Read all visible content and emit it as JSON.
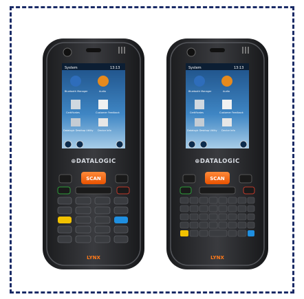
{
  "products": [
    {
      "name": "numeric",
      "brand": "⊕DATALOGIC",
      "scan_label": "SCAN",
      "model_mark": "LYNX",
      "screen": {
        "status_left": "System",
        "status_right": "13:13",
        "tiles": [
          "Bluetooth Manager",
          "Audio",
          "Certificates",
          "Customer Feedback",
          "Datalogic Desktop Utility",
          "Device Info"
        ]
      }
    },
    {
      "name": "qwerty",
      "brand": "⊕DATALOGIC",
      "scan_label": "SCAN",
      "model_mark": "LYNX",
      "screen": {
        "status_left": "System",
        "status_right": "13:13",
        "tiles": [
          "Bluetooth Manager",
          "Audio",
          "Certificates",
          "Customer Feedback",
          "Datalogic Desktop Utility",
          "Device Info"
        ]
      }
    }
  ],
  "colors": {
    "frame": "#1a2b66",
    "body": "#2d2e31",
    "accent": "#ff6a13"
  }
}
